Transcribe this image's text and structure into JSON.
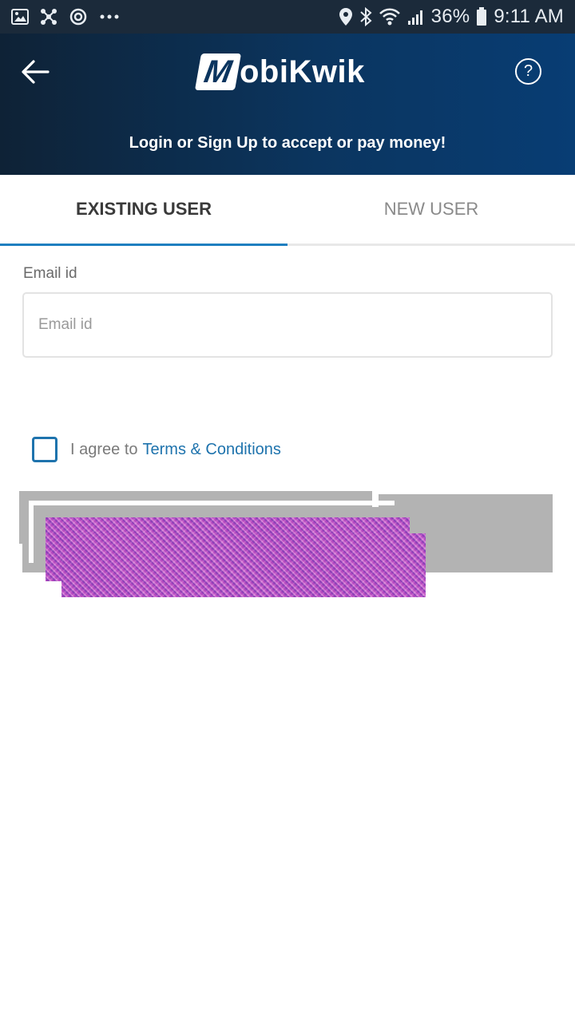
{
  "status_bar": {
    "battery": "36%",
    "time": "9:11 AM",
    "icons": [
      "image-icon",
      "network-icon",
      "sync-icon",
      "more-icon",
      "location-icon",
      "bluetooth-icon",
      "wifi-icon",
      "signal-icon",
      "battery-icon"
    ]
  },
  "header": {
    "logo_mark": "M",
    "logo_text": "obiKwik",
    "subtitle": "Login or Sign Up to accept or pay money!",
    "help_glyph": "?"
  },
  "tabs": [
    {
      "label": "EXISTING USER",
      "active": true
    },
    {
      "label": "NEW USER",
      "active": false
    }
  ],
  "form": {
    "email_label": "Email id",
    "email_placeholder": "Email id",
    "email_value": "",
    "agree_text": "I agree to",
    "terms_link": "Terms & Conditions",
    "agree_checked": false
  },
  "colors": {
    "header_start": "#0e2236",
    "header_end": "#083d74",
    "accent": "#1e7fc0",
    "link": "#1e73ad",
    "button_gray": "#b3b3b3"
  }
}
